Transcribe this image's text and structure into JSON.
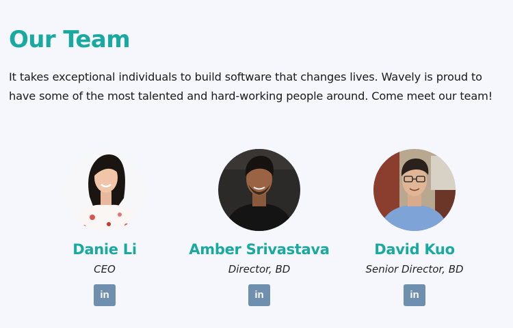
{
  "title": "Our Team",
  "intro": "It takes exceptional individuals to build software that changes lives. Wavely is proud to have some of the most talented and hard-working people around. Come meet our team!",
  "members": [
    {
      "name": "Danie Li",
      "role": "CEO",
      "social_icon": "linkedin-icon",
      "social_label": "in"
    },
    {
      "name": "Amber Srivastava",
      "role": "Director, BD",
      "social_icon": "linkedin-icon",
      "social_label": "in"
    },
    {
      "name": "David Kuo",
      "role": "Senior Director, BD",
      "social_icon": "linkedin-icon",
      "social_label": "in"
    }
  ],
  "colors": {
    "background": "#f6f6fd",
    "accent": "#1aa9a0",
    "social_button": "#6f8fae"
  }
}
